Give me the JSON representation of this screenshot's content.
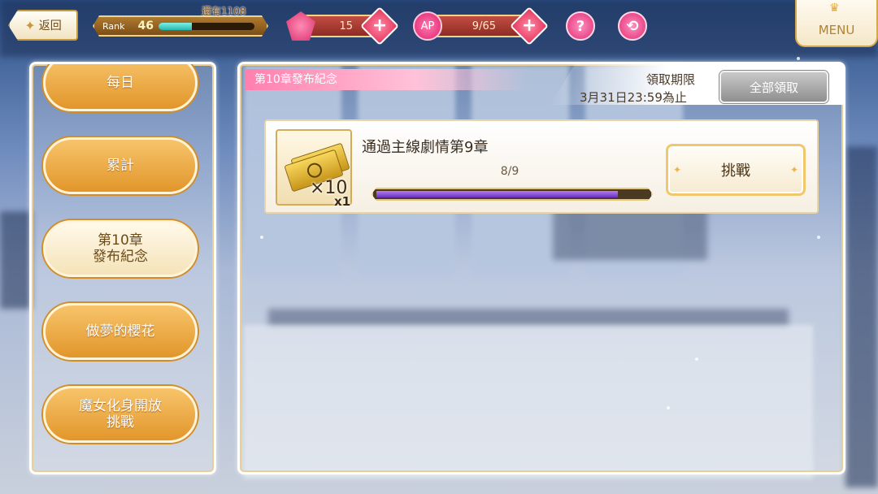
{
  "topbar": {
    "back_label": "返回",
    "rank_label": "Rank",
    "rank_value": "46",
    "rank_progress": 0.35,
    "rank_remaining": "還有1108",
    "gems_value": "15",
    "ap_label": "AP",
    "ap_value": "9/65",
    "help_icon": "?",
    "menu_label": "MENU"
  },
  "sidebar": {
    "items": [
      {
        "label": "每日",
        "active": false
      },
      {
        "label": "累計",
        "active": false
      },
      {
        "label": "第10章\n發布紀念",
        "active": true
      },
      {
        "label": "做夢的櫻花",
        "active": false
      },
      {
        "label": "魔女化身開放\n挑戰",
        "active": false
      }
    ]
  },
  "main": {
    "ribbon_title": "第10章發布紀念",
    "deadline_label": "領取期限",
    "deadline_time": "3月31日23:59為止",
    "claim_all_label": "全部領取",
    "missions": [
      {
        "reward_qty": "×10",
        "reward_count": "x1",
        "title": "通過主線劇情第9章",
        "progress_text": "8/9",
        "progress": 0.889,
        "button_label": "挑戰"
      }
    ]
  },
  "colors": {
    "accent_gold": "#e2962b",
    "ribbon_pink": "#ff7fae",
    "progress_purple": "#6a2fc2"
  }
}
